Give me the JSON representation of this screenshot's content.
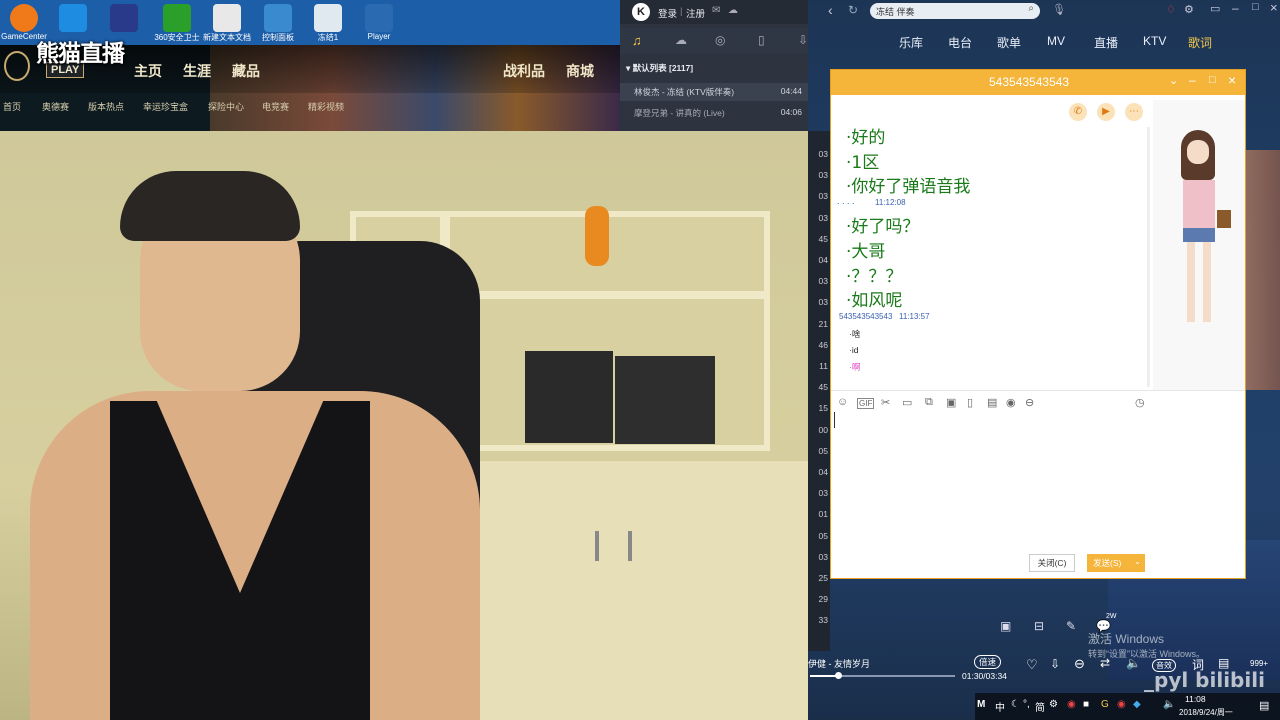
{
  "desktop": {
    "icons": [
      {
        "label": "GameCenter",
        "icon": "gamecenter-icon",
        "color": "#f07a1a"
      },
      {
        "label": "",
        "icon": "teamviewer-icon",
        "color": "#1e8ce0"
      },
      {
        "label": "",
        "icon": "kx-icon",
        "color": "#2a3a8a"
      },
      {
        "label": "360安全卫士",
        "icon": "360-icon",
        "color": "#2aa02a"
      },
      {
        "label": "新建文本文档",
        "icon": "textfile-icon",
        "color": "#e8e8e8"
      },
      {
        "label": "控制面板",
        "icon": "controlpanel-icon",
        "color": "#3a8ad0"
      },
      {
        "label": "冻结1",
        "icon": "doc-icon",
        "color": "#e0e8f0"
      },
      {
        "label": "Player",
        "icon": "player-icon",
        "color": "#2a6ab0"
      }
    ]
  },
  "watermark": {
    "text": "熊猫直播"
  },
  "lol": {
    "play": "PLAY",
    "nav": [
      "主页",
      "生涯",
      "藏品",
      "战利品",
      "商城"
    ],
    "subnav": [
      "首页",
      "奥德赛",
      "版本热点",
      "幸运珍宝盒",
      "探险中心",
      "电竞赛",
      "精彩视频"
    ]
  },
  "kugou": {
    "login": "登录",
    "register": "注册",
    "playlist_title": "默认列表 [2117]",
    "rows": [
      {
        "name": "林俊杰 - 冻结 (KTV版伴奏)",
        "time": "04:44"
      },
      {
        "name": "摩登兄弟 - 讲真的 (Live)",
        "time": "04:06"
      },
      {
        "name": "",
        "time": ""
      }
    ],
    "numbers": [
      "03",
      "03",
      "03",
      "03",
      "45",
      "04",
      "03",
      "03",
      "21",
      "46",
      "11",
      "45",
      "15",
      "00",
      "05",
      "04",
      "03",
      "01",
      "05",
      "03",
      "25",
      "29",
      "33"
    ]
  },
  "right_app": {
    "search_value": "冻结 伴奏",
    "nav": [
      "乐库",
      "电台",
      "歌单",
      "MV",
      "直播",
      "KTV",
      "歌词"
    ],
    "active_nav_color": "#f7c84a"
  },
  "chat": {
    "title": "543543543543",
    "messages": [
      "·好的",
      "·1区",
      "·你好了弹语音我",
      "·好了吗？",
      "·大哥",
      "·？？？",
      "·如风呢"
    ],
    "dots": ". . . .",
    "time1": "11:12:08",
    "sender2": "543543543543",
    "time2": "11:13:57",
    "small_messages": [
      {
        "text": "·啥",
        "color": "#222"
      },
      {
        "text": "·id",
        "color": "#222"
      },
      {
        "text": "·啊",
        "color": "#e040c0"
      }
    ],
    "close_label": "关闭(C)",
    "send_label": "发送(S)",
    "toolbar": [
      "smile-icon",
      "gif-icon",
      "scissors-icon",
      "folder-icon",
      "shake-icon",
      "image-icon",
      "phone-icon",
      "calendar-icon",
      "music-icon",
      "more-icon"
    ]
  },
  "player": {
    "song": "伊健 - 友情岁月",
    "speed": "倍速",
    "time": "01:30/03:34",
    "quality": "音效",
    "badge": "999+",
    "comment_badge": "2W"
  },
  "windows": {
    "activate_title": "激活 Windows",
    "activate_sub": "转到“设置”以激活 Windows。",
    "clock_time": "11:08",
    "clock_date": "2018/9/24/周一",
    "bilibili": "_pyl bilibili"
  },
  "colors": {
    "chat_title": "#f5b43a",
    "send_btn": "#f5b43a",
    "msg_green": "#1a7a1a"
  }
}
